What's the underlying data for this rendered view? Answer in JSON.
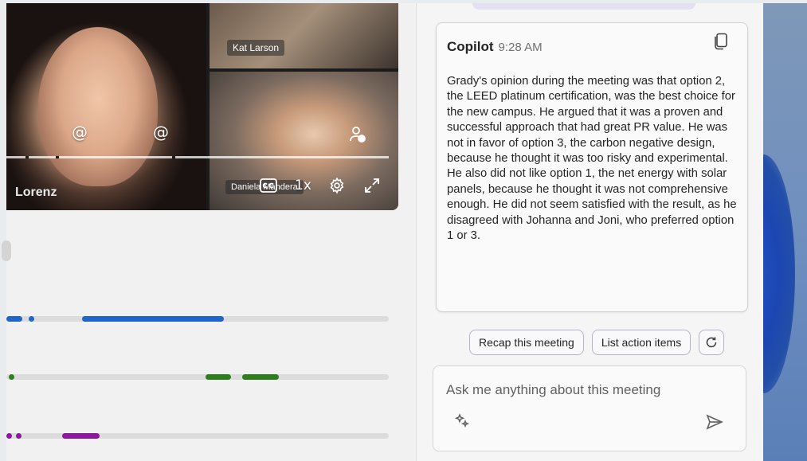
{
  "participants": {
    "main_name": "Lorenz",
    "top_right_name": "Kat Larson",
    "bottom_right_name": "Daniela Mandera"
  },
  "video_controls": {
    "mention_icon_1": "at-icon",
    "mention_icon_2": "at-icon",
    "add_person_icon": "person-add-icon",
    "captions_icon": "closed-captions-icon",
    "speed_label": "1x",
    "settings_icon": "gear-icon",
    "expand_icon": "expand-icon"
  },
  "timeline": {
    "tracks": [
      {
        "color": "#1e66c9"
      },
      {
        "color": "#2f7d1e"
      },
      {
        "color": "#8a1a9b"
      }
    ]
  },
  "copilot": {
    "sender": "Copilot",
    "time": "9:28 AM",
    "copy_icon": "copy-icon",
    "message": "Grady's opinion during the meeting was that option 2, the LEED platinum certification, was the best choice for the new campus. He argued that it was a proven and successful approach that had great PR value. He was not in favor of option 3, the carbon negative design, because he thought it was too risky and experimental. He also did not like option 1, the net energy with solar panels, because he thought it was not comprehensive enough. He did not seem satisfied with the result, as he disagreed with Johanna and Joni, who preferred option 1 or 3."
  },
  "suggestions": {
    "chip_1": "Recap this meeting",
    "chip_2": "List action items",
    "refresh_icon": "refresh-icon"
  },
  "compose": {
    "placeholder": "Ask me anything about this meeting",
    "prompt_icon": "sparkle-icon",
    "send_icon": "send-icon"
  },
  "colors": {
    "accent_blue": "#1e66c9",
    "accent_green": "#2f7d1e",
    "accent_purple": "#8a1a9b"
  }
}
